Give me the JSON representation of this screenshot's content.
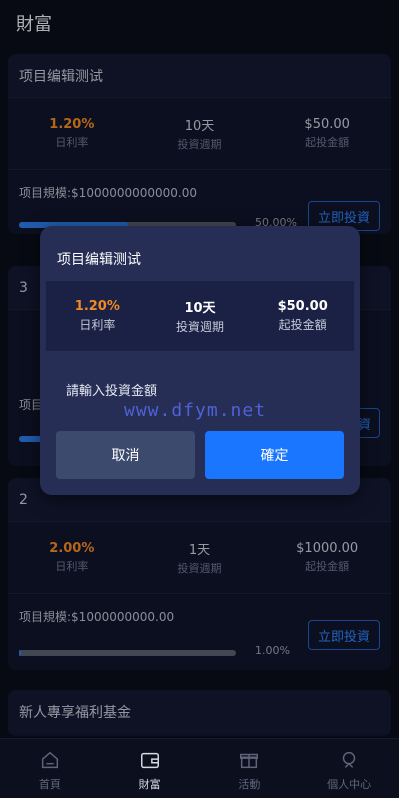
{
  "header": {
    "title": "財富"
  },
  "cards": [
    {
      "title": "项目编辑测试",
      "stats": [
        {
          "value": "1.20%",
          "label": "日利率"
        },
        {
          "value": "10天",
          "label": "投資週期"
        },
        {
          "value": "$50.00",
          "label": "起投金額"
        }
      ],
      "scale": "项目規模:$1000000000000.00",
      "percent_text": "50.00%",
      "progress": 0.5,
      "button": "立即投資"
    },
    {
      "title": "3",
      "scale_prefix": "项目",
      "button": "投資"
    },
    {
      "title": "2",
      "stats": [
        {
          "value": "2.00%",
          "label": "日利率"
        },
        {
          "value": "1天",
          "label": "投資週期"
        },
        {
          "value": "$1000.00",
          "label": "起投金額"
        }
      ],
      "scale": "项目規模:$1000000000.00",
      "percent_text": "1.00%",
      "progress": 0.01,
      "button": "立即投資"
    },
    {
      "title": "新人專享福利基金"
    }
  ],
  "modal": {
    "title": "项目编辑测试",
    "stats": [
      {
        "value": "1.20%",
        "label": "日利率"
      },
      {
        "value": "10天",
        "label": "投資週期"
      },
      {
        "value": "$50.00",
        "label": "起投金額"
      }
    ],
    "input_label": "請輸入投資金額",
    "watermark": "www.dfym.net",
    "cancel": "取消",
    "confirm": "確定"
  },
  "tabbar": [
    {
      "label": "首頁",
      "icon": "home-icon"
    },
    {
      "label": "財富",
      "icon": "wallet-icon",
      "active": true
    },
    {
      "label": "活動",
      "icon": "gift-icon"
    },
    {
      "label": "個人中心",
      "icon": "user-icon"
    }
  ],
  "colors": {
    "accent": "#1a76ff",
    "rate": "#f28a22",
    "background": "#0b0e1a",
    "modal": "#262e55"
  }
}
